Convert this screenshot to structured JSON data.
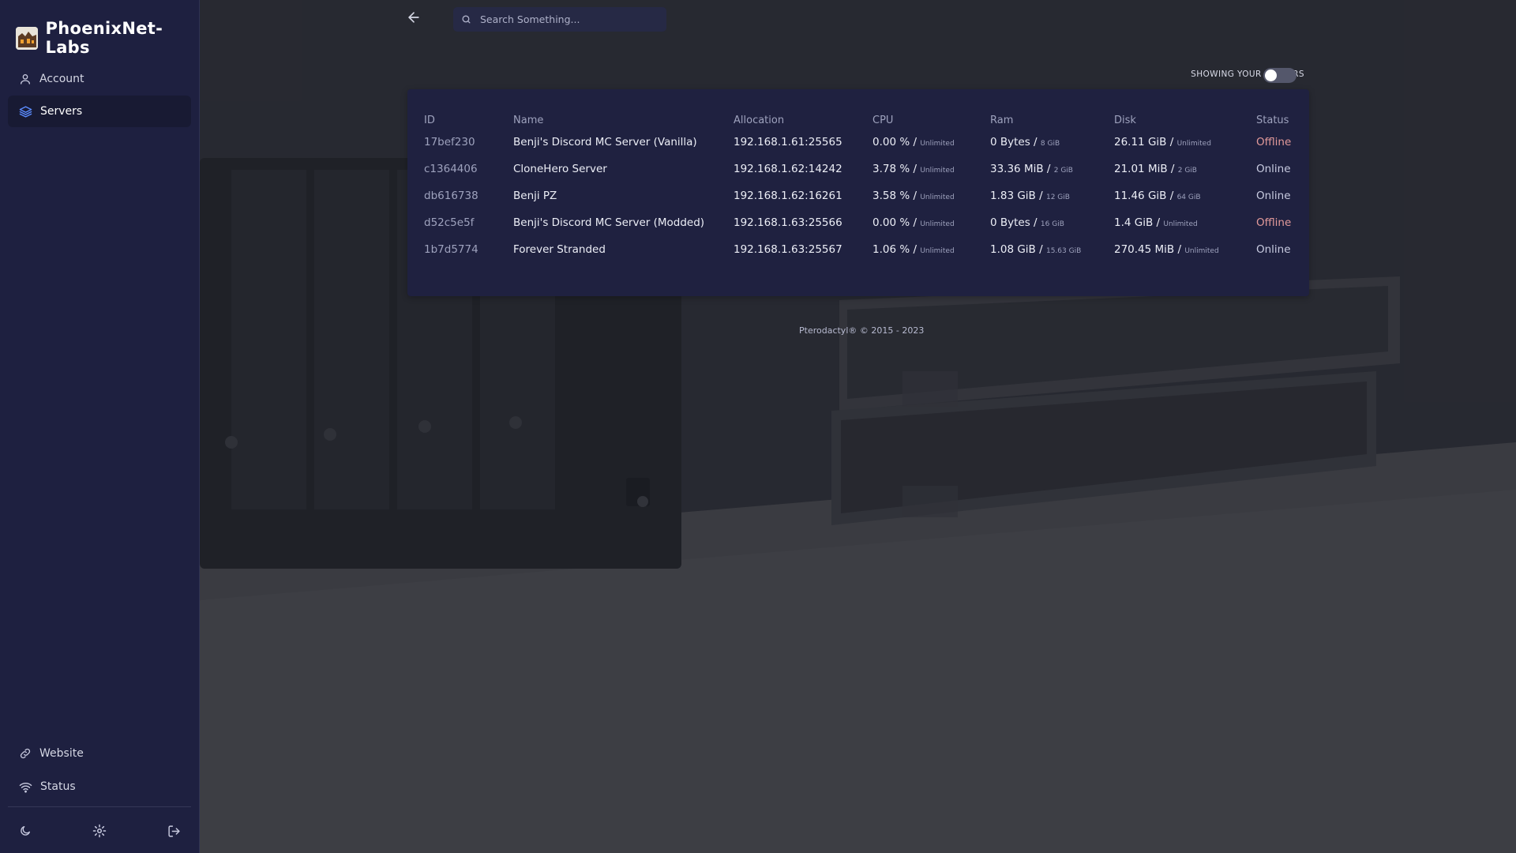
{
  "brand": {
    "name": "PhoenixNet-Labs"
  },
  "sidebar": {
    "items": [
      {
        "label": "Account",
        "icon": "user-icon"
      },
      {
        "label": "Servers",
        "icon": "layers-icon",
        "active": true
      }
    ],
    "bottom_links": [
      {
        "label": "Website",
        "icon": "link-icon"
      },
      {
        "label": "Status",
        "icon": "wifi-icon"
      }
    ],
    "bottom_icons": [
      "moon-icon",
      "gear-icon",
      "logout-icon"
    ]
  },
  "search": {
    "placeholder": "Search Something..."
  },
  "toggle": {
    "label": "SHOWING YOUR SERVERS",
    "on": false
  },
  "table": {
    "headers": [
      "ID",
      "Name",
      "Allocation",
      "CPU",
      "Ram",
      "Disk",
      "Status"
    ],
    "rows": [
      {
        "id": "17bef230",
        "name": "Benji's Discord MC Server (Vanilla)",
        "allocation": "192.168.1.61:25565",
        "cpu": "0.00 %",
        "cpu_limit": "Unlimited",
        "ram": "0 Bytes",
        "ram_limit": "8 GiB",
        "disk": "26.11 GiB",
        "disk_limit": "Unlimited",
        "status": "Offline"
      },
      {
        "id": "c1364406",
        "name": "CloneHero Server",
        "allocation": "192.168.1.62:14242",
        "cpu": "3.78 %",
        "cpu_limit": "Unlimited",
        "ram": "33.36 MiB",
        "ram_limit": "2 GiB",
        "disk": "21.01 MiB",
        "disk_limit": "2 GiB",
        "status": "Online"
      },
      {
        "id": "db616738",
        "name": "Benji PZ",
        "allocation": "192.168.1.62:16261",
        "cpu": "3.58 %",
        "cpu_limit": "Unlimited",
        "ram": "1.83 GiB",
        "ram_limit": "12 GiB",
        "disk": "11.46 GiB",
        "disk_limit": "64 GiB",
        "status": "Online"
      },
      {
        "id": "d52c5e5f",
        "name": "Benji's Discord MC Server (Modded)",
        "allocation": "192.168.1.63:25566",
        "cpu": "0.00 %",
        "cpu_limit": "Unlimited",
        "ram": "0 Bytes",
        "ram_limit": "16 GiB",
        "disk": "1.4 GiB",
        "disk_limit": "Unlimited",
        "status": "Offline"
      },
      {
        "id": "1b7d5774",
        "name": "Forever Stranded",
        "allocation": "192.168.1.63:25567",
        "cpu": "1.06 %",
        "cpu_limit": "Unlimited",
        "ram": "1.08 GiB",
        "ram_limit": "15.63 GiB",
        "disk": "270.45 MiB",
        "disk_limit": "Unlimited",
        "status": "Online"
      }
    ]
  },
  "footer": {
    "text": "Pterodactyl® © 2015 - 2023"
  },
  "colors": {
    "sidebar_bg": "#1e2040",
    "panel_bg": "#1f2140",
    "offline": "#e39a9a",
    "online": "#c8cbe0"
  }
}
